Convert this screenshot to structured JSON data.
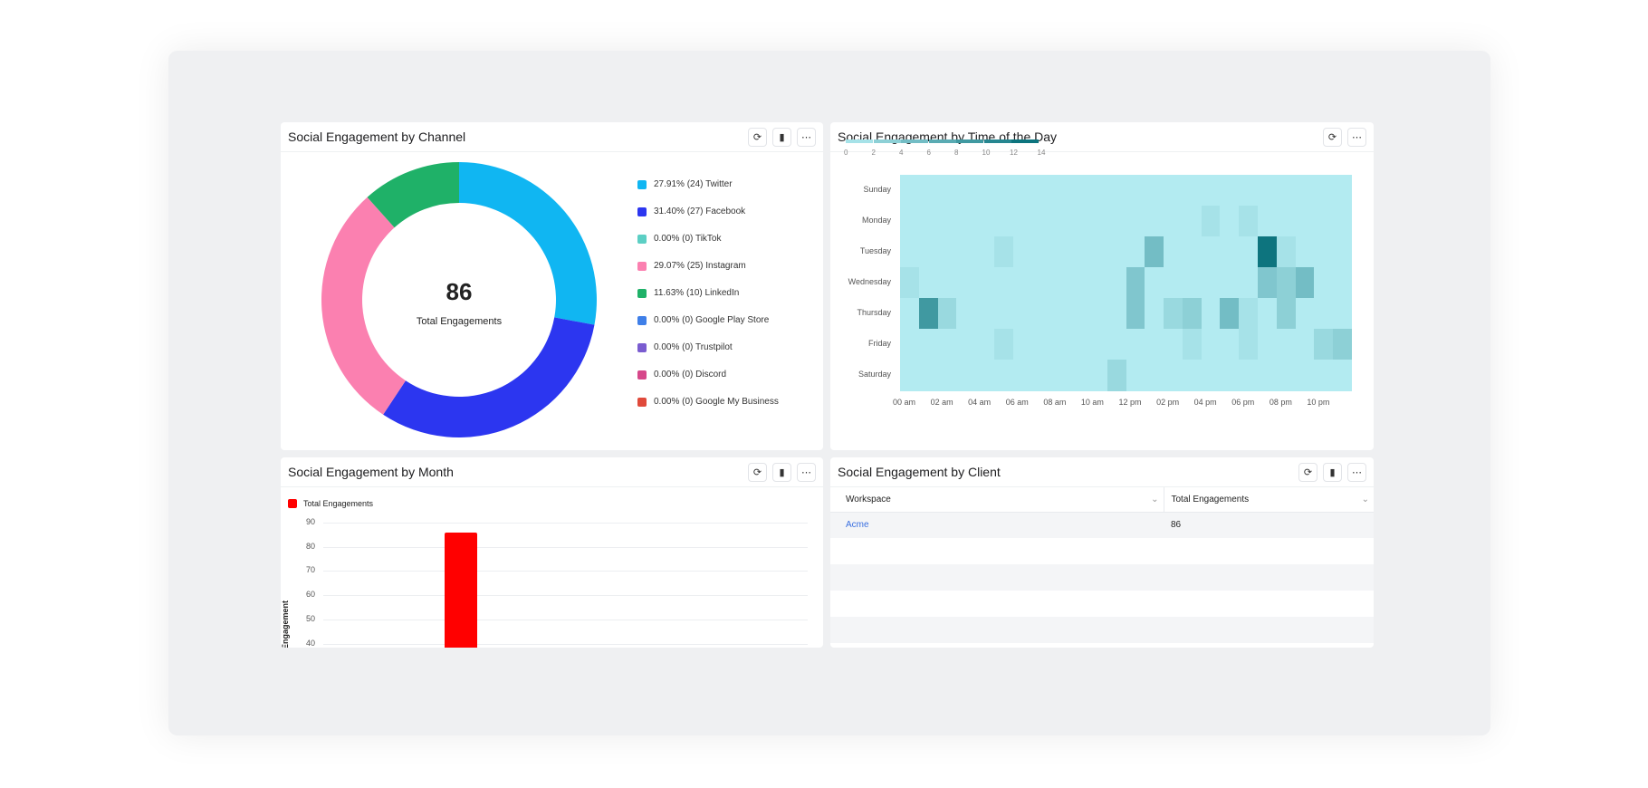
{
  "panels": {
    "channel": {
      "title": "Social Engagement by Channel",
      "total": "86",
      "total_label": "Total Engagements"
    },
    "time": {
      "title": "Social Engagement by Time of the Day"
    },
    "month": {
      "title": "Social Engagement by Month",
      "legend": "Total Engagements",
      "ylabel": "Engagement"
    },
    "client": {
      "title": "Social Engagement by Client",
      "columns": [
        "Workspace",
        "Total Engagements"
      ],
      "rows": [
        {
          "workspace": "Acme",
          "total": "86"
        }
      ]
    }
  },
  "icons": {
    "refresh": "refresh-icon",
    "chart": "bar-chart-icon",
    "more": "more-icon"
  },
  "chart_data": [
    {
      "type": "pie",
      "variant": "donut",
      "title": "Social Engagement by Channel",
      "slices": [
        {
          "label": "27.91% (24) Twitter",
          "name": "Twitter",
          "value": 24,
          "color": "#10b6f2"
        },
        {
          "label": "31.40% (27) Facebook",
          "name": "Facebook",
          "value": 27,
          "color": "#2c36f0"
        },
        {
          "label": "0.00% (0) TikTok",
          "name": "TikTok",
          "value": 0,
          "color": "#5ccfc4"
        },
        {
          "label": "29.07% (25) Instagram",
          "name": "Instagram",
          "value": 25,
          "color": "#fb80b0"
        },
        {
          "label": "11.63% (10) LinkedIn",
          "name": "LinkedIn",
          "value": 10,
          "color": "#1fb168"
        },
        {
          "label": "0.00% (0) Google Play Store",
          "name": "Google Play Store",
          "value": 0,
          "color": "#3f7fe8"
        },
        {
          "label": "0.00% (0) Trustpilot",
          "name": "Trustpilot",
          "value": 0,
          "color": "#7a5cd0"
        },
        {
          "label": "0.00% (0) Discord",
          "name": "Discord",
          "value": 0,
          "color": "#d6478a"
        },
        {
          "label": "0.00% (0) Google My Business",
          "name": "Google My Business",
          "value": 0,
          "color": "#e04a3b"
        }
      ],
      "legend": "right"
    },
    {
      "type": "heatmap",
      "title": "Social Engagement by Time of the Day",
      "rows": [
        "Sunday",
        "Monday",
        "Tuesday",
        "Wednesday",
        "Thursday",
        "Friday",
        "Saturday"
      ],
      "x_ticks": [
        "00 am",
        "02 am",
        "04 am",
        "06 am",
        "08 am",
        "10 am",
        "12 pm",
        "02 pm",
        "04 pm",
        "06 pm",
        "08 pm",
        "10 pm"
      ],
      "scale_ticks": [
        "0",
        "2",
        "4",
        "6",
        "8",
        "10",
        "12",
        "14"
      ],
      "scale_range": [
        0,
        14
      ],
      "color_low": "#b3ebf1",
      "color_high": "#006b75",
      "values": [
        [
          0,
          0,
          0,
          0,
          0,
          0,
          0,
          0,
          0,
          0,
          0,
          0,
          0,
          0,
          0,
          0,
          0,
          0,
          0,
          0,
          0,
          0,
          0,
          0
        ],
        [
          0,
          0,
          0,
          0,
          0,
          0,
          0,
          0,
          0,
          0,
          0,
          0,
          0,
          0,
          0,
          0,
          1,
          0,
          1,
          0,
          0,
          0,
          0,
          0
        ],
        [
          0,
          0,
          0,
          0,
          0,
          1,
          0,
          0,
          0,
          0,
          0,
          0,
          0,
          5,
          0,
          0,
          0,
          0,
          0,
          13,
          1,
          0,
          0,
          0
        ],
        [
          1,
          0,
          0,
          0,
          0,
          0,
          0,
          0,
          0,
          0,
          0,
          0,
          4,
          0,
          0,
          0,
          0,
          0,
          0,
          4,
          3,
          5,
          0,
          0
        ],
        [
          0,
          9,
          2,
          0,
          0,
          0,
          0,
          0,
          0,
          0,
          0,
          0,
          4,
          0,
          2,
          3,
          0,
          5,
          1,
          0,
          3,
          0,
          0,
          0
        ],
        [
          0,
          0,
          0,
          0,
          0,
          1,
          0,
          0,
          0,
          0,
          0,
          0,
          0,
          0,
          0,
          1,
          0,
          0,
          1,
          0,
          0,
          0,
          2,
          3
        ],
        [
          0,
          0,
          0,
          0,
          0,
          0,
          0,
          0,
          0,
          0,
          0,
          2,
          0,
          0,
          0,
          0,
          0,
          0,
          0,
          0,
          0,
          0,
          0,
          0
        ]
      ]
    },
    {
      "type": "bar",
      "title": "Social Engagement by Month",
      "series": [
        {
          "name": "Total Engagements",
          "values": [
            86
          ],
          "color": "#ff0000"
        }
      ],
      "ylabel": "Engagement",
      "y_ticks": [
        40,
        50,
        60,
        70,
        80,
        90
      ],
      "ylim_visible": [
        40,
        90
      ],
      "grid": true,
      "legend": "top-left"
    }
  ]
}
